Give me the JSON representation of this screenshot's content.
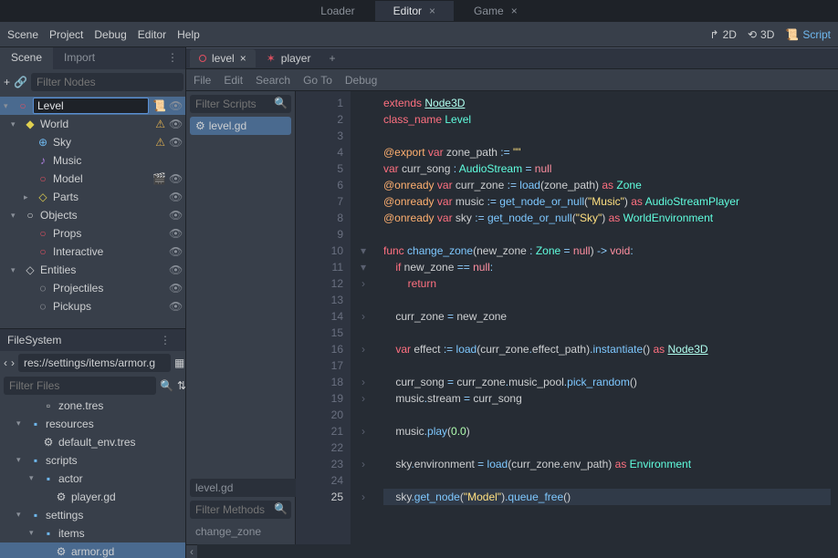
{
  "top_tabs": {
    "loader": "Loader",
    "editor": "Editor",
    "game": "Game"
  },
  "menu": {
    "scene": "Scene",
    "project": "Project",
    "debug": "Debug",
    "editor": "Editor",
    "help": "Help"
  },
  "mode": {
    "d2": "2D",
    "d3": "3D",
    "script": "Script"
  },
  "left_panel": {
    "tabs": {
      "scene": "Scene",
      "import": "Import"
    },
    "filter_placeholder": "Filter Nodes",
    "selected_name": "Level",
    "tree": [
      {
        "indent": 0,
        "chev": "▾",
        "icon": "◆",
        "cls": "ic-yellow",
        "label": "World",
        "warn": true,
        "vis": true
      },
      {
        "indent": 1,
        "chev": "",
        "icon": "⊕",
        "cls": "ic-blue",
        "label": "Sky",
        "warn": true,
        "vis": true
      },
      {
        "indent": 1,
        "chev": "",
        "icon": "♪",
        "cls": "ic-purple",
        "label": "Music",
        "warn": false,
        "vis": false
      },
      {
        "indent": 1,
        "chev": "",
        "icon": "○",
        "cls": "ic-red",
        "label": "Model",
        "clap": true,
        "vis": true
      },
      {
        "indent": 1,
        "chev": "▸",
        "icon": "◇",
        "cls": "ic-yellow",
        "label": "Parts",
        "vis": true
      },
      {
        "indent": 0,
        "chev": "▾",
        "icon": "○",
        "cls": "",
        "label": "Objects",
        "vis": true
      },
      {
        "indent": 1,
        "chev": "",
        "icon": "○",
        "cls": "ic-red",
        "label": "Props",
        "vis": true
      },
      {
        "indent": 1,
        "chev": "",
        "icon": "○",
        "cls": "ic-red",
        "label": "Interactive",
        "vis": true
      },
      {
        "indent": 0,
        "chev": "▾",
        "icon": "◇",
        "cls": "",
        "label": "Entities",
        "vis": true
      },
      {
        "indent": 1,
        "chev": "",
        "icon": "◌",
        "cls": "",
        "label": "Projectiles",
        "vis": true
      },
      {
        "indent": 1,
        "chev": "",
        "icon": "◌",
        "cls": "",
        "label": "Pickups",
        "vis": true
      }
    ]
  },
  "filesystem": {
    "title": "FileSystem",
    "path": "res://settings/items/armor.g",
    "filter_placeholder": "Filter Files",
    "tree": [
      {
        "indent": 2,
        "icon": "▫",
        "label": "zone.tres"
      },
      {
        "indent": 1,
        "icon": "▪",
        "cls": "ic-blue",
        "label": "resources",
        "chev": "▾"
      },
      {
        "indent": 2,
        "icon": "⚙",
        "label": "default_env.tres"
      },
      {
        "indent": 1,
        "icon": "▪",
        "cls": "ic-blue",
        "label": "scripts",
        "chev": "▾"
      },
      {
        "indent": 2,
        "icon": "▪",
        "cls": "ic-blue",
        "label": "actor",
        "chev": "▾"
      },
      {
        "indent": 3,
        "icon": "⚙",
        "label": "player.gd"
      },
      {
        "indent": 1,
        "icon": "▪",
        "cls": "ic-blue",
        "label": "settings",
        "chev": "▾"
      },
      {
        "indent": 2,
        "icon": "▪",
        "cls": "ic-blue",
        "label": "items",
        "chev": "▾"
      },
      {
        "indent": 3,
        "icon": "⚙",
        "label": "armor.gd",
        "selected": true
      }
    ]
  },
  "editor": {
    "tabs": [
      {
        "label": "level",
        "color": "#e05060",
        "active": true,
        "close": true
      },
      {
        "label": "player",
        "color": "#e05060",
        "icon": "✶"
      }
    ],
    "add_tab": "+",
    "menu": {
      "file": "File",
      "edit": "Edit",
      "search": "Search",
      "goto": "Go To",
      "debug": "Debug"
    },
    "sidebar": {
      "filter_scripts": "Filter Scripts",
      "script": "level.gd",
      "current": "level.gd",
      "filter_methods": "Filter Methods",
      "method": "change_zone"
    }
  },
  "chart_data": {
    "type": "code",
    "language": "gdscript",
    "active_line": 25,
    "lines_visible": [
      1,
      25
    ],
    "lines": [
      "extends Node3D",
      "class_name Level",
      "",
      "@export var zone_path := \"\"",
      "var curr_song : AudioStream = null",
      "@onready var curr_zone := load(zone_path) as Zone",
      "@onready var music := get_node_or_null(\"Music\") as AudioStreamPlayer",
      "@onready var sky := get_node_or_null(\"Sky\") as WorldEnvironment",
      "",
      "func change_zone(new_zone : Zone = null) -> void:",
      "    if new_zone == null:",
      "        return",
      "",
      "    curr_zone = new_zone",
      "",
      "    var effect := load(curr_zone.effect_path).instantiate() as Node3D",
      "",
      "    curr_song = curr_zone.music_pool.pick_random()",
      "    music.stream = curr_song",
      "",
      "    music.play(0.0)",
      "",
      "    sky.environment = load(curr_zone.env_path) as Environment",
      "",
      "    sky.get_node(\"Model\").queue_free()"
    ]
  }
}
